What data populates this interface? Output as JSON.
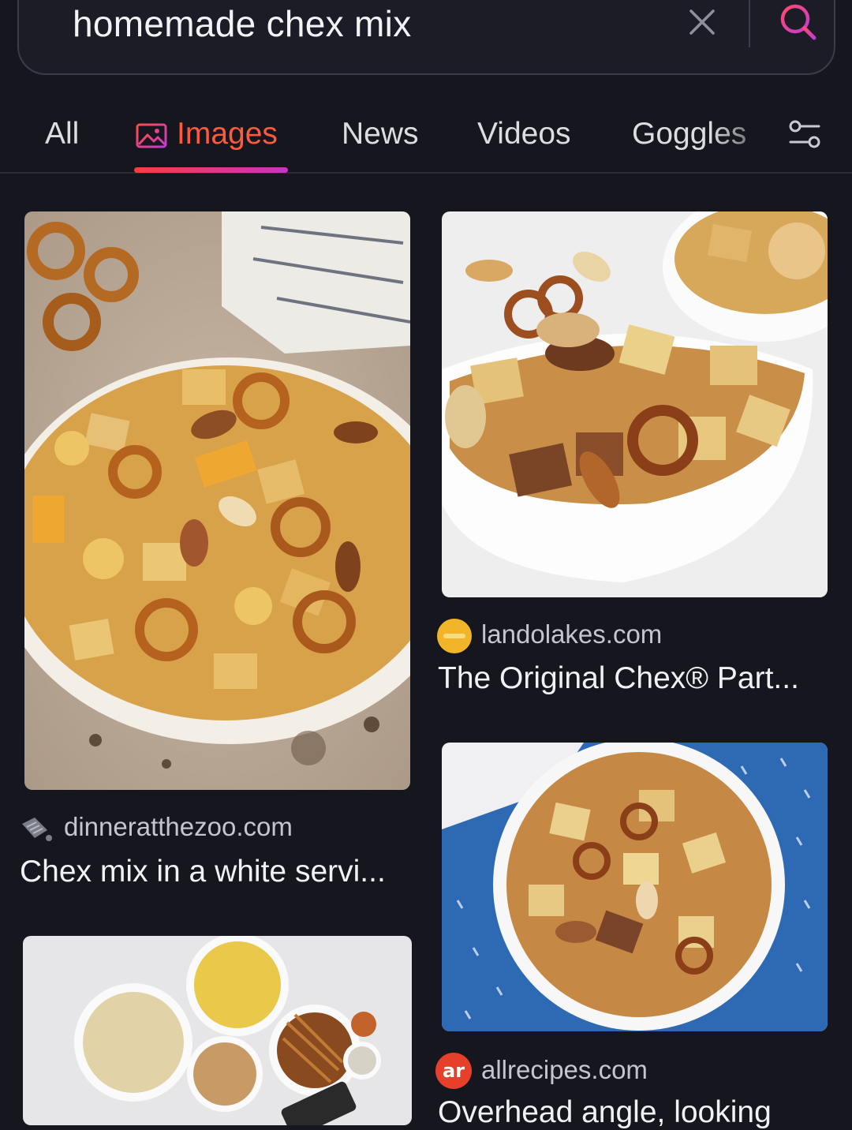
{
  "search": {
    "query": "homemade chex mix"
  },
  "tabs": [
    {
      "label": "All"
    },
    {
      "label": "Images"
    },
    {
      "label": "News"
    },
    {
      "label": "Videos"
    },
    {
      "label": "Goggles"
    }
  ],
  "active_tab": "Images",
  "colors": {
    "accent": "#ff5a3c",
    "background": "#15161e"
  },
  "results": [
    {
      "domain": "dinneratthezoo.com",
      "title": "Chex mix in a white servi..."
    },
    {
      "domain": "landolakes.com",
      "title": "The Original Chex® Part..."
    },
    {
      "domain": "allrecipes.com",
      "title": "Overhead angle, looking"
    }
  ],
  "favicons": {
    "allrecipes": "ar"
  },
  "icons": {
    "clear": "close-icon",
    "search": "search-icon",
    "images_tab": "image-icon",
    "filter": "filter-settings-icon"
  }
}
